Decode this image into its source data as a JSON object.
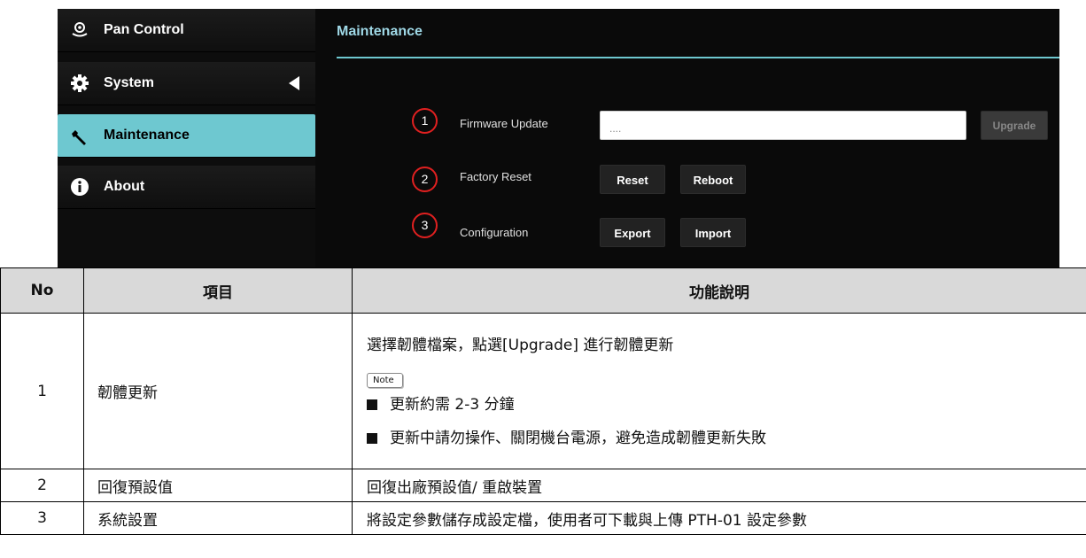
{
  "sidebar": {
    "items": [
      {
        "label": "Pan Control",
        "icon": "camera-icon"
      },
      {
        "label": "System",
        "icon": "gear-icon"
      },
      {
        "label": "Maintenance",
        "icon": "wrench-icon",
        "active": true
      },
      {
        "label": "About",
        "icon": "info-icon"
      }
    ]
  },
  "main": {
    "title": "Maintenance",
    "rows": [
      {
        "num": "1",
        "label": "Firmware Update",
        "input_placeholder": "....",
        "upgrade_label": "Upgrade"
      },
      {
        "num": "2",
        "label": "Factory Reset",
        "reset_label": "Reset",
        "reboot_label": "Reboot"
      },
      {
        "num": "3",
        "label": "Configuration",
        "export_label": "Export",
        "import_label": "Import"
      }
    ]
  },
  "table": {
    "headers": {
      "no": "No",
      "item": "項目",
      "desc": "功能說明"
    },
    "rows": [
      {
        "no": "1",
        "item": "韌體更新",
        "desc": "選擇韌體檔案，點選[Upgrade]  進行韌體更新",
        "note_label": "Note",
        "bullets": [
          "更新約需 2-3 分鐘",
          "更新中請勿操作、關閉機台電源，避免造成韌體更新失敗"
        ]
      },
      {
        "no": "2",
        "item": "回復預設值",
        "desc": "回復出廠預設值/  重啟裝置"
      },
      {
        "no": "3",
        "item": "系統設置",
        "desc": "將設定參數儲存成設定檔，使用者可下載與上傳 PTH-01 設定參數"
      }
    ]
  },
  "colors": {
    "accent": "#6ec8d0",
    "badge": "#e02020",
    "title": "#9fd8e6"
  }
}
